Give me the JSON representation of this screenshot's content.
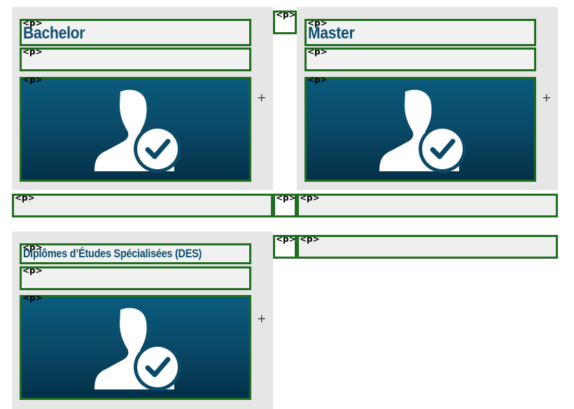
{
  "tag_label": "<p>",
  "add_label": "+",
  "colors": {
    "panel": "#e6e6e6",
    "outline": "#1e6e1e",
    "title": "#0c4f6e",
    "media_top": "#0b5a7c",
    "media_bottom": "#043049"
  },
  "cards": [
    {
      "title": "Bachelor",
      "icon": "user-check-icon"
    },
    {
      "title": "Master",
      "icon": "user-check-icon"
    },
    {
      "title": "Diplômes d’Études Spécialisées (DES)",
      "icon": "user-check-icon"
    }
  ]
}
